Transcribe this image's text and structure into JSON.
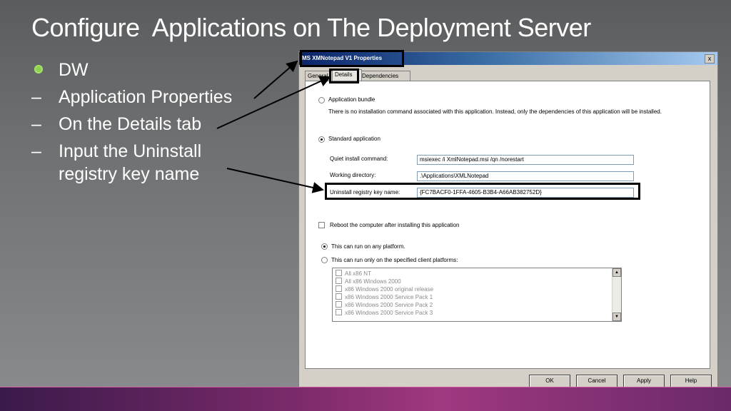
{
  "slide": {
    "title": "Configure  Applications on The Deployment Server",
    "bullets": [
      {
        "marker": "dot",
        "text": "DW"
      },
      {
        "marker": "–",
        "text": "Application Properties"
      },
      {
        "marker": "–",
        "text": "On the Details tab"
      },
      {
        "marker": "–",
        "text": "Input the Uninstall registry key name"
      }
    ]
  },
  "dialog": {
    "title": "MS XMNotepad V1 Properties",
    "close_glyph": "x",
    "tabs": [
      "General",
      "Details",
      "Dependencies"
    ],
    "active_tab": "Details",
    "app_bundle_label": "Application bundle",
    "app_bundle_desc": "There is no installation command associated with this application.  Instead, only the dependencies of this application will be installed.",
    "standard_label": "Standard application",
    "quiet_label": "Quiet install command:",
    "quiet_value": "msiexec /i XmlNotepad.msi /qn /norestart",
    "workdir_label": "Working directory:",
    "workdir_value": ".\\Applications\\XMLNotepad",
    "uninstall_label": "Uninstall registry key name:",
    "uninstall_value": "{FC7BACF0-1FFA-4605-B3B4-A66AB382752D}",
    "reboot_label": "Reboot the computer after installing this application",
    "any_platform_label": "This can run on any platform.",
    "specified_platform_label": "This can run only on the specified client platforms:",
    "platforms": [
      "All x86 NT",
      "All x86 Windows 2000",
      "x86 Windows 2000 original release",
      "x86 Windows 2000 Service Pack 1",
      "x86 Windows 2000 Service Pack 2",
      "x86 Windows 2000 Service Pack 3"
    ],
    "buttons": {
      "ok": "OK",
      "cancel": "Cancel",
      "apply": "Apply",
      "help": "Help"
    }
  },
  "colors": {
    "bullet_dot": "#8fd14f",
    "titlebar_start": "#0a246a",
    "titlebar_end": "#a6caf0",
    "highlight_box": "#000000"
  }
}
